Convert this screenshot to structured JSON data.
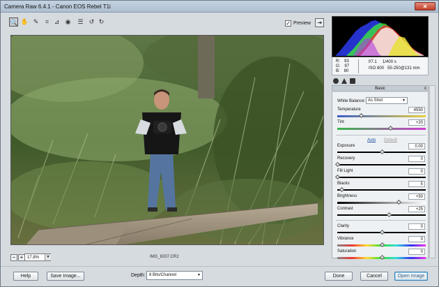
{
  "window": {
    "title": "Camera Raw 6.4.1  -  Canon EOS Rebel T1i",
    "close_label": "✕"
  },
  "toolbar": {
    "tools": [
      {
        "name": "zoom-tool-icon",
        "glyph": "🔍"
      },
      {
        "name": "hand-tool-icon",
        "glyph": "✋"
      },
      {
        "name": "white-balance-tool-icon",
        "glyph": "✎"
      },
      {
        "name": "crop-tool-icon",
        "glyph": "⌗"
      },
      {
        "name": "straighten-tool-icon",
        "glyph": "⊿"
      },
      {
        "name": "red-eye-tool-icon",
        "glyph": "◉"
      },
      {
        "name": "preferences-icon",
        "glyph": "☰"
      },
      {
        "name": "rotate-left-icon",
        "glyph": "↺"
      },
      {
        "name": "rotate-right-icon",
        "glyph": "↻"
      }
    ],
    "preview_label": "Preview",
    "preview_checked": "✓",
    "fullscreen_glyph": "⇥"
  },
  "status": {
    "zoom_minus": "−",
    "zoom_plus": "+",
    "zoom_value": "17.8%",
    "zoom_arrow": "▼",
    "filename": "IMG_8337.CR2"
  },
  "info": {
    "r_label": "R:",
    "r_value": "93",
    "g_label": "G:",
    "g_value": "97",
    "b_label": "B:",
    "b_value": "80",
    "aperture": "f/7.1",
    "shutter": "1/400 s",
    "iso": "ISO 800",
    "lens": "55-250@131 mm"
  },
  "panel": {
    "title": "Basic",
    "menu_glyph": "≡",
    "white_balance_label": "White Balance:",
    "white_balance_value": "As Shot",
    "select_arrow": "▼",
    "auto_label": "Auto",
    "default_label": "Default",
    "sliders": [
      {
        "key": "temperature",
        "label": "Temperature",
        "value": "4550",
        "pos": 0.27,
        "track": "temp"
      },
      {
        "key": "tint",
        "label": "Tint",
        "value": "+20",
        "pos": 0.6,
        "track": "tint"
      },
      {
        "key": "exposure",
        "label": "Exposure",
        "value": "0.00",
        "pos": 0.5,
        "track": "plain"
      },
      {
        "key": "recovery",
        "label": "Recovery",
        "value": "0",
        "pos": 0.0,
        "track": "plain"
      },
      {
        "key": "fill-light",
        "label": "Fill Light",
        "value": "0",
        "pos": 0.0,
        "track": "plain"
      },
      {
        "key": "blacks",
        "label": "Blacks",
        "value": "5",
        "pos": 0.05,
        "track": "plain"
      },
      {
        "key": "brightness",
        "label": "Brightness",
        "value": "+50",
        "pos": 0.69,
        "track": "bright"
      },
      {
        "key": "contrast",
        "label": "Contrast",
        "value": "+25",
        "pos": 0.58,
        "track": "plain"
      },
      {
        "key": "clarity",
        "label": "Clarity",
        "value": "0",
        "pos": 0.5,
        "track": "plain"
      },
      {
        "key": "vibrance",
        "label": "Vibrance",
        "value": "0",
        "pos": 0.5,
        "track": "vib"
      },
      {
        "key": "saturation",
        "label": "Saturation",
        "value": "0",
        "pos": 0.5,
        "track": "sat"
      }
    ]
  },
  "bottom": {
    "help": "Help",
    "save_image": "Save Image...",
    "depth_label": "Depth:",
    "depth_value": "8 Bits/Channel",
    "done": "Done",
    "cancel": "Cancel",
    "open_image": "Open Image"
  }
}
